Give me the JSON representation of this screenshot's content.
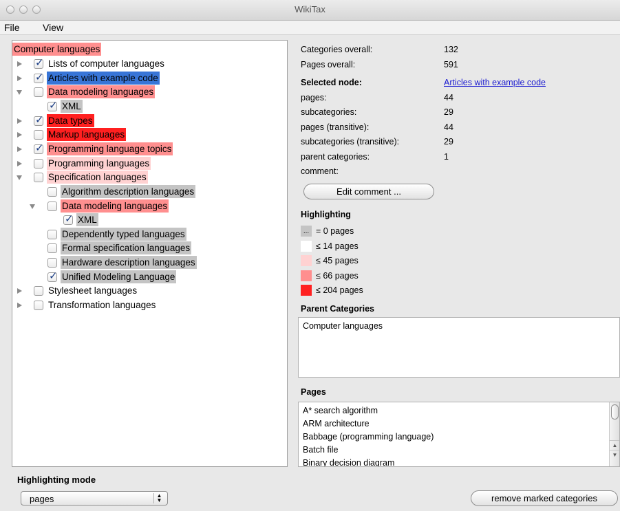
{
  "window": {
    "title": "WikiTax"
  },
  "menu": {
    "file": "File",
    "view": "View"
  },
  "tree": {
    "root": "Computer languages",
    "items": [
      {
        "label": "Lists of computer languages",
        "checked": true,
        "expander": "right",
        "level": 1,
        "highlight": "none"
      },
      {
        "label": "Articles with example code",
        "checked": true,
        "expander": "right",
        "level": 1,
        "highlight": "selected"
      },
      {
        "label": "Data modeling languages",
        "checked": false,
        "expander": "down",
        "level": 1,
        "highlight": "mid"
      },
      {
        "label": "XML",
        "checked": true,
        "expander": "none",
        "level": 2,
        "highlight": "gray"
      },
      {
        "label": "Data types",
        "checked": true,
        "expander": "right",
        "level": 1,
        "highlight": "red"
      },
      {
        "label": "Markup languages",
        "checked": false,
        "expander": "right",
        "level": 1,
        "highlight": "red"
      },
      {
        "label": "Programming language topics",
        "checked": true,
        "expander": "right",
        "level": 1,
        "highlight": "mid"
      },
      {
        "label": "Programming languages",
        "checked": false,
        "expander": "right",
        "level": 1,
        "highlight": "light"
      },
      {
        "label": "Specification languages",
        "checked": false,
        "expander": "down",
        "level": 1,
        "highlight": "light"
      },
      {
        "label": "Algorithm description languages",
        "checked": false,
        "expander": "none",
        "level": 2,
        "highlight": "gray"
      },
      {
        "label": "Data modeling languages",
        "checked": false,
        "expander": "down",
        "level": 2,
        "highlight": "mid"
      },
      {
        "label": "XML",
        "checked": true,
        "expander": "none",
        "level": 3,
        "highlight": "gray"
      },
      {
        "label": "Dependently typed languages",
        "checked": false,
        "expander": "none",
        "level": 2,
        "highlight": "gray"
      },
      {
        "label": "Formal specification languages",
        "checked": false,
        "expander": "none",
        "level": 2,
        "highlight": "gray"
      },
      {
        "label": "Hardware description languages",
        "checked": false,
        "expander": "none",
        "level": 2,
        "highlight": "gray"
      },
      {
        "label": "Unified Modeling Language",
        "checked": true,
        "expander": "none",
        "level": 2,
        "highlight": "gray"
      },
      {
        "label": "Stylesheet languages",
        "checked": false,
        "expander": "right",
        "level": 1,
        "highlight": "none"
      },
      {
        "label": "Transformation languages",
        "checked": false,
        "expander": "right",
        "level": 1,
        "highlight": "none"
      }
    ]
  },
  "stats": {
    "categories_overall_label": "Categories overall:",
    "categories_overall_value": "132",
    "pages_overall_label": "Pages overall:",
    "pages_overall_value": "591",
    "selected_node_label": "Selected node:",
    "selected_node_value": "Articles with example code",
    "pages_label": "pages:",
    "pages_value": "44",
    "subcategories_label": "subcategories:",
    "subcategories_value": "29",
    "pages_transitive_label": "pages (transitive):",
    "pages_transitive_value": "44",
    "subcategories_transitive_label": "subcategories (transitive):",
    "subcategories_transitive_value": "29",
    "parent_categories_label": "parent categories:",
    "parent_categories_value": "1",
    "comment_label": "comment:",
    "edit_comment_button": "Edit comment ..."
  },
  "highlighting": {
    "title": "Highlighting",
    "legend": [
      {
        "label": "= 0 pages",
        "color": "#c4c4c4",
        "swatch_text": "..."
      },
      {
        "label": "≤ 14 pages",
        "color": "#ffffff",
        "swatch_text": ""
      },
      {
        "label": "≤ 45 pages",
        "color": "#ffd2d2",
        "swatch_text": ""
      },
      {
        "label": "≤ 66 pages",
        "color": "#ff8f8f",
        "swatch_text": ""
      },
      {
        "label": "≤ 204 pages",
        "color": "#ff2020",
        "swatch_text": ""
      }
    ]
  },
  "parent_categories": {
    "title": "Parent Categories",
    "items": [
      "Computer languages"
    ]
  },
  "pages": {
    "title": "Pages",
    "items": [
      "A* search algorithm",
      "ARM architecture",
      "Babbage (programming language)",
      "Batch file",
      "Binary decision diagram"
    ]
  },
  "bottom": {
    "mode_title": "Highlighting mode",
    "mode_selected": "pages",
    "remove_button": "remove marked categories"
  },
  "colors": {
    "selected": "#3875d7",
    "gray": "#c4c4c4",
    "light": "#ffd2d2",
    "mid": "#ff8f8f",
    "red": "#ff2020"
  }
}
